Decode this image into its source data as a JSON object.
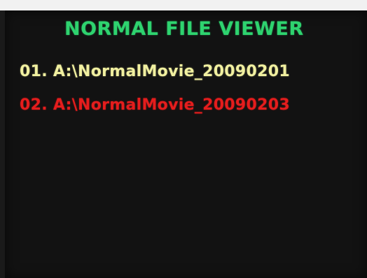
{
  "viewer": {
    "title": "NORMAL FILE VIEWER",
    "title_color": "#2ed36f",
    "items": [
      {
        "label": "01. A:\\NormalMovie_20090201",
        "state": "normal",
        "color": "#f1f0a0"
      },
      {
        "label": "02. A:\\NormalMovie_20090203",
        "state": "selected",
        "color": "#e51d1d"
      }
    ],
    "background_color": "#121212"
  }
}
